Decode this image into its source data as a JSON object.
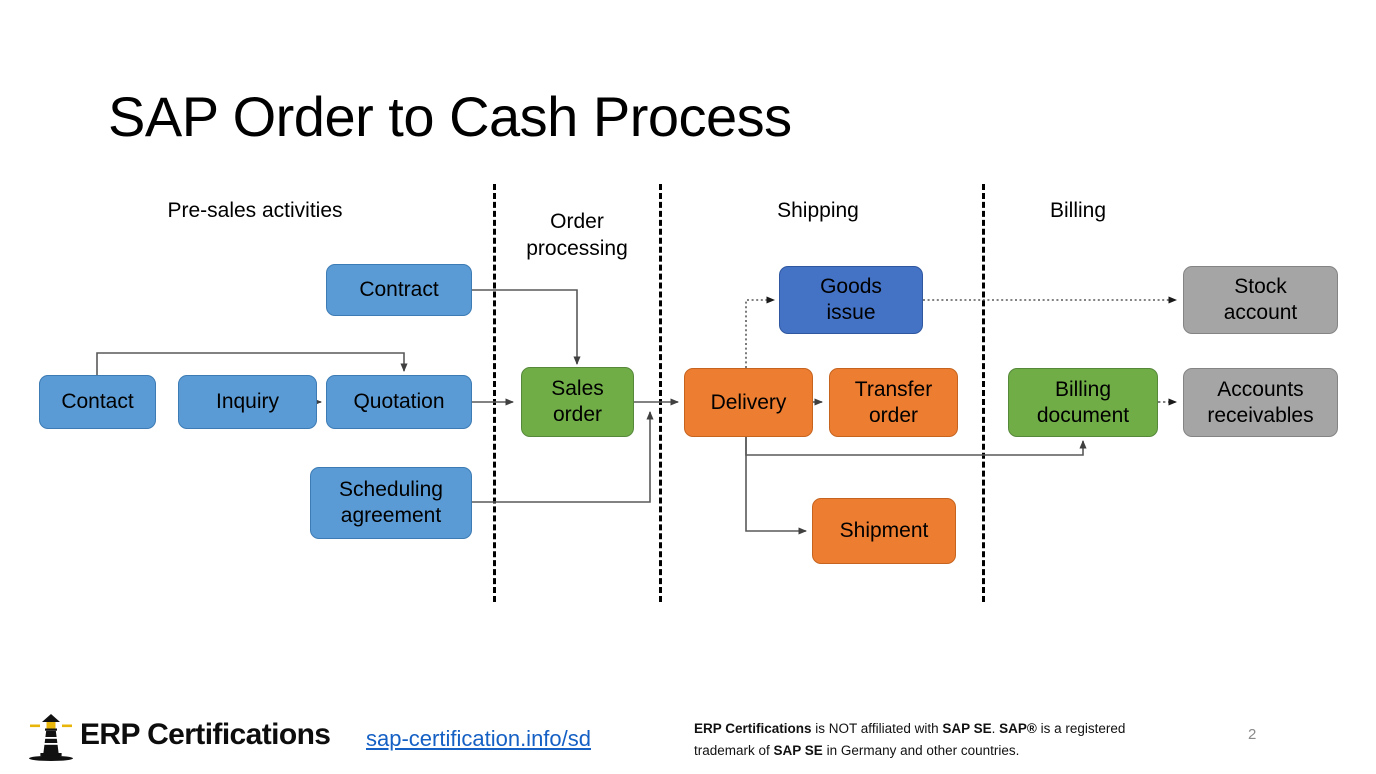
{
  "slide": {
    "title": "SAP Order to Cash Process",
    "page_number": "2"
  },
  "phases": [
    {
      "label": "Pre-sales activities"
    },
    {
      "label": "Order\nprocessing"
    },
    {
      "label": "Shipping"
    },
    {
      "label": "Billing"
    }
  ],
  "nodes": {
    "contact": "Contact",
    "inquiry": "Inquiry",
    "quotation": "Quotation",
    "contract": "Contract",
    "scheduling_agreement": "Scheduling\nagreement",
    "sales_order": "Sales\norder",
    "delivery": "Delivery",
    "goods_issue": "Goods\nissue",
    "transfer_order": "Transfer\norder",
    "shipment": "Shipment",
    "billing_document": "Billing\ndocument",
    "stock_account": "Stock\naccount",
    "accounts_receivables": "Accounts\nreceivables"
  },
  "colors": {
    "blue": "#5B9BD5",
    "dark_blue": "#4472C4",
    "green": "#70AD47",
    "orange": "#ED7D31",
    "gray": "#A5A5A5",
    "link": "#1560C4",
    "page_number": "#8a8a8a"
  },
  "footer": {
    "brand": "ERP Certifications",
    "link": "sap-certification.info/sd",
    "disclaimer_parts": [
      {
        "text": "ERP Certifications",
        "bold": true
      },
      {
        "text": " is NOT affiliated with ",
        "bold": false
      },
      {
        "text": "SAP SE",
        "bold": true
      },
      {
        "text": ". ",
        "bold": false
      },
      {
        "text": "SAP®",
        "bold": true
      },
      {
        "text": " is a registered trademark of ",
        "bold": false
      },
      {
        "text": "SAP SE",
        "bold": true
      },
      {
        "text": " in Germany and other countries.",
        "bold": false
      }
    ]
  },
  "chart_data": {
    "type": "diagram",
    "title": "SAP Order to Cash Process",
    "lanes": [
      "Pre-sales activities",
      "Order processing",
      "Shipping",
      "Billing"
    ],
    "nodes": [
      {
        "id": "contact",
        "label": "Contact",
        "lane": "Pre-sales activities",
        "color": "#5B9BD5"
      },
      {
        "id": "inquiry",
        "label": "Inquiry",
        "lane": "Pre-sales activities",
        "color": "#5B9BD5"
      },
      {
        "id": "quotation",
        "label": "Quotation",
        "lane": "Pre-sales activities",
        "color": "#5B9BD5"
      },
      {
        "id": "contract",
        "label": "Contract",
        "lane": "Pre-sales activities",
        "color": "#5B9BD5"
      },
      {
        "id": "scheduling_agreement",
        "label": "Scheduling agreement",
        "lane": "Pre-sales activities",
        "color": "#5B9BD5"
      },
      {
        "id": "sales_order",
        "label": "Sales order",
        "lane": "Order processing",
        "color": "#70AD47"
      },
      {
        "id": "delivery",
        "label": "Delivery",
        "lane": "Shipping",
        "color": "#ED7D31"
      },
      {
        "id": "goods_issue",
        "label": "Goods issue",
        "lane": "Shipping",
        "color": "#4472C4"
      },
      {
        "id": "transfer_order",
        "label": "Transfer order",
        "lane": "Shipping",
        "color": "#ED7D31"
      },
      {
        "id": "shipment",
        "label": "Shipment",
        "lane": "Shipping",
        "color": "#ED7D31"
      },
      {
        "id": "billing_document",
        "label": "Billing document",
        "lane": "Billing",
        "color": "#70AD47"
      },
      {
        "id": "stock_account",
        "label": "Stock account",
        "lane": "Billing",
        "color": "#A5A5A5"
      },
      {
        "id": "accounts_receivables",
        "label": "Accounts receivables",
        "lane": "Billing",
        "color": "#A5A5A5"
      }
    ],
    "edges": [
      {
        "from": "contact",
        "to": "quotation",
        "style": "solid"
      },
      {
        "from": "inquiry",
        "to": "quotation",
        "style": "solid"
      },
      {
        "from": "quotation",
        "to": "sales_order",
        "style": "solid"
      },
      {
        "from": "contract",
        "to": "sales_order",
        "style": "solid"
      },
      {
        "from": "scheduling_agreement",
        "to": "sales_order",
        "style": "solid"
      },
      {
        "from": "sales_order",
        "to": "delivery",
        "style": "solid"
      },
      {
        "from": "delivery",
        "to": "goods_issue",
        "style": "dotted"
      },
      {
        "from": "delivery",
        "to": "transfer_order",
        "style": "solid"
      },
      {
        "from": "delivery",
        "to": "shipment",
        "style": "solid"
      },
      {
        "from": "delivery",
        "to": "billing_document",
        "style": "solid"
      },
      {
        "from": "goods_issue",
        "to": "stock_account",
        "style": "dotted"
      },
      {
        "from": "billing_document",
        "to": "accounts_receivables",
        "style": "dotted"
      }
    ]
  }
}
